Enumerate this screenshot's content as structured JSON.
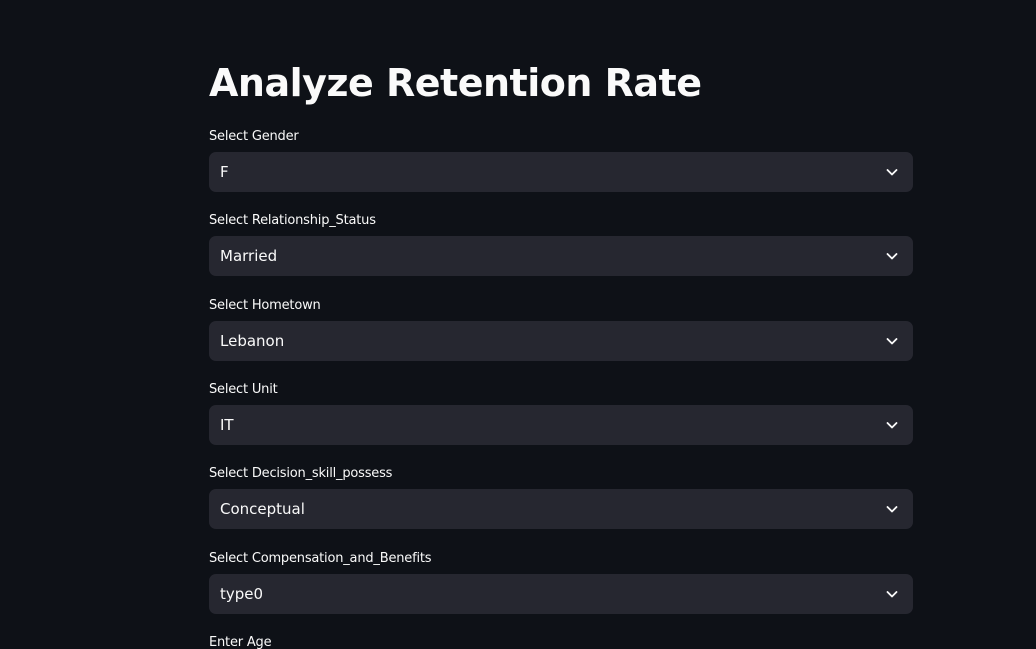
{
  "page": {
    "title": "Analyze Retention Rate"
  },
  "fields": [
    {
      "label": "Select Gender",
      "value": "F"
    },
    {
      "label": "Select Relationship_Status",
      "value": "Married"
    },
    {
      "label": "Select Hometown",
      "value": "Lebanon"
    },
    {
      "label": "Select Unit",
      "value": "IT"
    },
    {
      "label": "Select Decision_skill_possess",
      "value": "Conceptual"
    },
    {
      "label": "Select Compensation_and_Benefits",
      "value": "type0"
    },
    {
      "label": "Enter Age"
    }
  ],
  "icons": {
    "dropdown": "chevron-down-icon"
  },
  "colors": {
    "background": "#0e1117",
    "select_background": "#262730",
    "text": "#fafafa"
  }
}
